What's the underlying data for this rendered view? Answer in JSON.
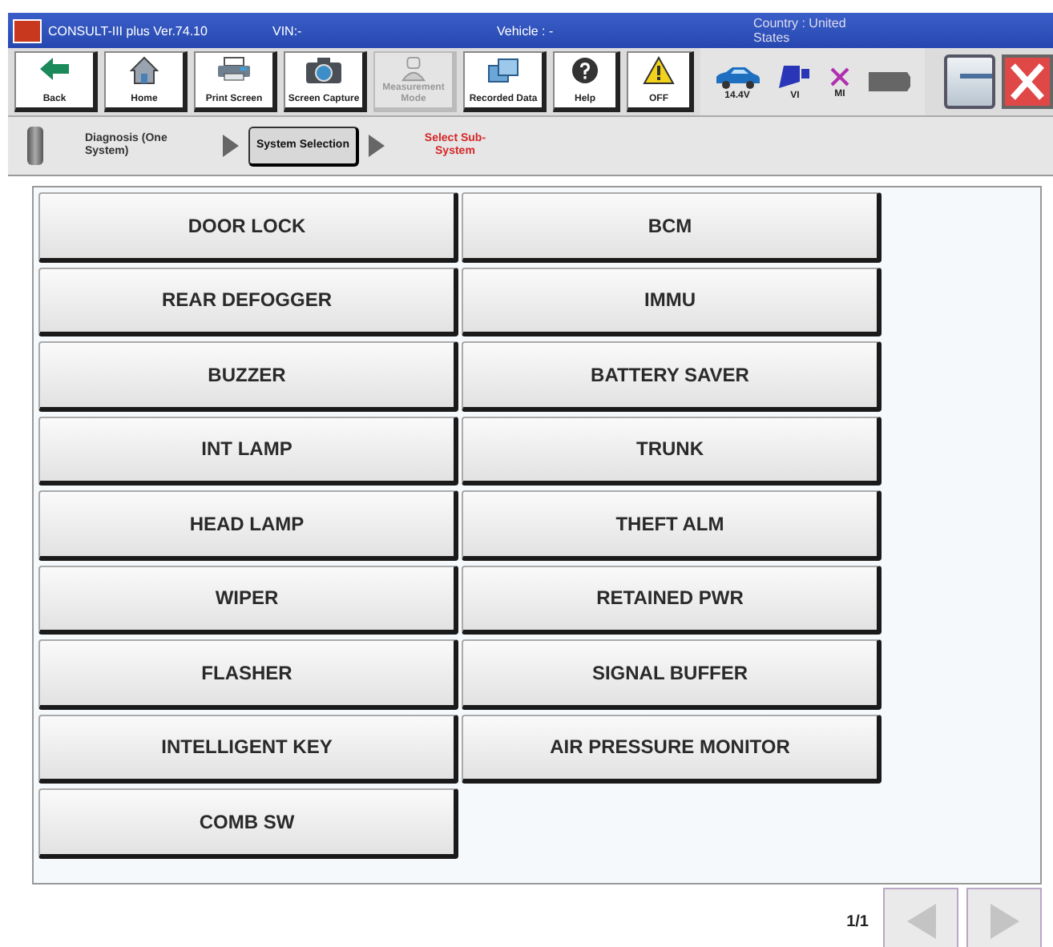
{
  "window": {
    "title": "CONSULT-III plus  Ver.74.10",
    "vin": "VIN:-",
    "vehicle": "Vehicle : -",
    "country": "Country : United States"
  },
  "toolbar": [
    {
      "kind": "back",
      "label": "Back",
      "disabled": false
    },
    {
      "kind": "home",
      "label": "Home",
      "disabled": false
    },
    {
      "kind": "print",
      "label": "Print Screen",
      "disabled": false
    },
    {
      "kind": "capture",
      "label": "Screen Capture",
      "disabled": false
    },
    {
      "kind": "measure",
      "label": "Measurement Mode",
      "disabled": true
    },
    {
      "kind": "recorded",
      "label": "Recorded Data",
      "disabled": false
    },
    {
      "kind": "help",
      "label": "Help",
      "disabled": false
    },
    {
      "kind": "off",
      "label": "OFF",
      "disabled": false
    }
  ],
  "status": [
    {
      "kind": "car",
      "label": "14.4V"
    },
    {
      "kind": "vi",
      "label": "VI"
    },
    {
      "kind": "mi",
      "label": "MI"
    },
    {
      "kind": "battery"
    }
  ],
  "breadcrumb": [
    {
      "kind": "done",
      "label": "Diagnosis (One System)"
    },
    {
      "kind": "current",
      "label": "System Selection"
    },
    {
      "kind": "next",
      "label": "Select Sub-System"
    }
  ],
  "systems": [
    "DOOR LOCK",
    "BCM",
    "REAR DEFOGGER",
    "IMMU",
    "BUZZER",
    "BATTERY SAVER",
    "INT LAMP",
    "TRUNK",
    "HEAD LAMP",
    "THEFT ALM",
    "WIPER",
    "RETAINED PWR",
    "FLASHER",
    "SIGNAL BUFFER",
    "INTELLIGENT KEY",
    "AIR PRESSURE MONITOR",
    "COMB SW"
  ],
  "pager": {
    "page": "1/1",
    "prev_disabled": true,
    "next_disabled": true
  }
}
